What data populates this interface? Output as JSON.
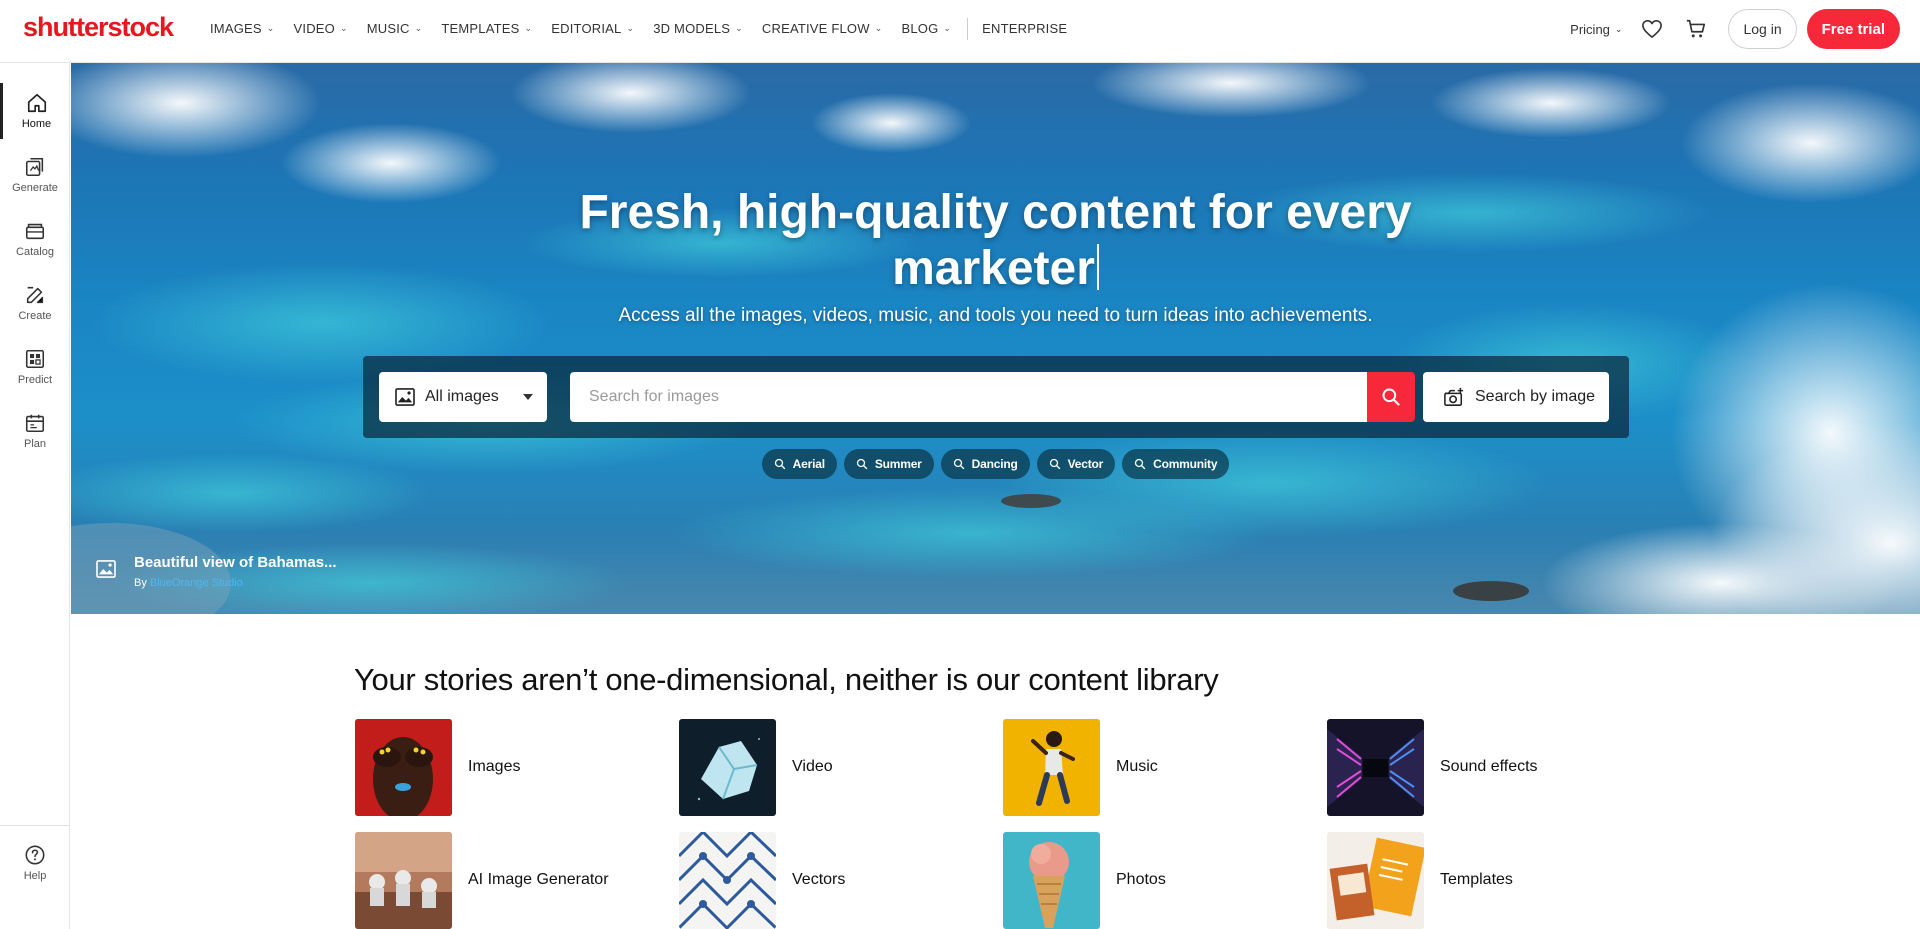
{
  "brand": {
    "logo": "shutterstock",
    "accent": "#f7283a"
  },
  "nav": {
    "items": [
      {
        "label": "IMAGES",
        "dropdown": true
      },
      {
        "label": "VIDEO",
        "dropdown": true
      },
      {
        "label": "MUSIC",
        "dropdown": true
      },
      {
        "label": "TEMPLATES",
        "dropdown": true
      },
      {
        "label": "EDITORIAL",
        "dropdown": true
      },
      {
        "label": "3D MODELS",
        "dropdown": true
      },
      {
        "label": "CREATIVE FLOW",
        "dropdown": true
      },
      {
        "label": "BLOG",
        "dropdown": true
      }
    ],
    "enterprise": "ENTERPRISE",
    "pricing": "Pricing",
    "login": "Log in",
    "free_trial": "Free trial"
  },
  "sidebar": {
    "items": [
      {
        "label": "Home",
        "icon": "home-icon",
        "active": true
      },
      {
        "label": "Generate",
        "icon": "generate-icon",
        "active": false
      },
      {
        "label": "Catalog",
        "icon": "catalog-icon",
        "active": false
      },
      {
        "label": "Create",
        "icon": "create-icon",
        "active": false
      },
      {
        "label": "Predict",
        "icon": "predict-icon",
        "active": false
      },
      {
        "label": "Plan",
        "icon": "plan-icon",
        "active": false
      }
    ],
    "help": "Help"
  },
  "hero": {
    "title_line1": "Fresh, high-quality content for every",
    "title_line2": "marketer",
    "subtitle": "Access all the images, videos, music, and tools you need to turn ideas into achievements.",
    "search": {
      "type_selected": "All images",
      "placeholder": "Search for images",
      "by_image": "Search by image"
    },
    "chips": [
      "Aerial",
      "Summer",
      "Dancing",
      "Vector",
      "Community"
    ],
    "credit": {
      "title": "Beautiful view of Bahamas...",
      "by": "By",
      "author": "BlueOrange Studio"
    }
  },
  "library": {
    "title": "Your stories aren’t one-dimensional, neither is our content library",
    "tiles": [
      {
        "label": "Images",
        "thumb": "images-thumb"
      },
      {
        "label": "Video",
        "thumb": "video-thumb"
      },
      {
        "label": "Music",
        "thumb": "music-thumb"
      },
      {
        "label": "Sound effects",
        "thumb": "sound-effects-thumb"
      },
      {
        "label": "AI Image Generator",
        "thumb": "ai-generator-thumb"
      },
      {
        "label": "Vectors",
        "thumb": "vectors-thumb"
      },
      {
        "label": "Photos",
        "thumb": "photos-thumb"
      },
      {
        "label": "Templates",
        "thumb": "templates-thumb"
      }
    ]
  }
}
